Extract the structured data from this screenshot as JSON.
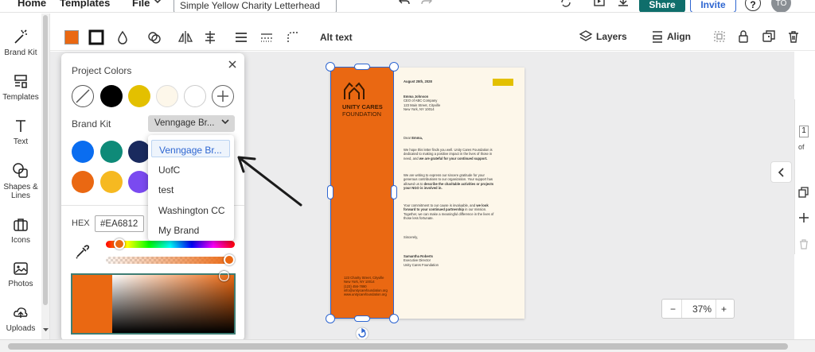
{
  "topbar": {
    "home_label": "Home",
    "templates_label": "Templates",
    "file_label": "File",
    "doc_title": "Simple Yellow Charity Letterhead",
    "share_label": "Share",
    "invite_label": "Invite",
    "help_label": "?",
    "avatar_initials": "TO"
  },
  "sidebar": {
    "items": [
      {
        "label": "Brand Kit",
        "icon": "magic-wand-icon"
      },
      {
        "label": "Templates",
        "icon": "templates-icon"
      },
      {
        "label": "Text",
        "icon": "text-icon"
      },
      {
        "label": "Shapes & Lines",
        "icon": "shapes-icon"
      },
      {
        "label": "Icons",
        "icon": "briefcase-icon"
      },
      {
        "label": "Photos",
        "icon": "image-icon"
      },
      {
        "label": "Uploads",
        "icon": "upload-icon"
      }
    ]
  },
  "toolbar": {
    "fill_color": "#EA6812",
    "alt_text_label": "Alt text",
    "layers_label": "Layers",
    "align_label": "Align"
  },
  "color_panel": {
    "project_colors_label": "Project Colors",
    "project_colors": [
      "none",
      "#000000",
      "#E3C000",
      "#FDF7EA",
      "#FFFFFF"
    ],
    "brand_kit_label": "Brand Kit",
    "brand_kit_selected": "Venngage Br...",
    "brand_colors": [
      "#0A6DF0",
      "#0E8A78",
      "#1A2A5E",
      "#EA6812",
      "#F6B921",
      "#7A4AF0"
    ],
    "hex_label": "HEX",
    "hex_value": "#EA6812",
    "hue_fraction": 0.07,
    "alpha_fraction": 1.0
  },
  "brand_dropdown": {
    "options": [
      "Venngage Br...",
      "UofC",
      "test",
      "Washington CC",
      "My Brand"
    ],
    "selected_index": 0
  },
  "letter": {
    "org_name_1": "UNITY CARES",
    "org_name_2": "FOUNDATION",
    "date": "August 25th, 2028",
    "recipient": [
      "Emma Johnson",
      "CEO of ABC Company",
      "123 Main Street, Cityville",
      "New York, NY 10014"
    ],
    "greeting_prefix": "Dear ",
    "greeting_name": "Emma,",
    "p1": [
      "We hope this letter finds you well. Unity Cares Foundation is",
      "dedicated to making a positive impact in the lives of those in",
      "need, and "
    ],
    "p1_bold": "we are grateful for your continued support.",
    "p2": [
      "We are writing to express our sincere gratitude for your",
      "generous contributions to our organization. Your support has",
      "allowed us to "
    ],
    "p2_bold_1": "describe the charitable activities or projects",
    "p2_bold_2": "your NGO is involved in.",
    "p3_1": "Your commitment to our cause is invaluable, and ",
    "p3_bold_1": "we look",
    "p3_bold_2": "forward to your continued partnership",
    "p3_2": " in our mission.",
    "p3_rest": [
      "Together, we can make a meaningful difference in the lives of",
      "those less fortunate."
    ],
    "closing": "Sincerely,",
    "signer_name": "Samantha Roberts",
    "signer_title": "Executive Director",
    "signer_org": "Unity Cares Foundation",
    "footer": [
      "123 Charity Street, Cityville",
      "New York, NY 10014",
      "(123) 456-7890",
      "info@unitycarefoundation.org",
      "www.unitycarefoundation.org"
    ]
  },
  "zoom": {
    "minus": "−",
    "value": "37%",
    "plus": "+"
  },
  "right_panel": {
    "page_number": "1",
    "page_of": "of"
  }
}
